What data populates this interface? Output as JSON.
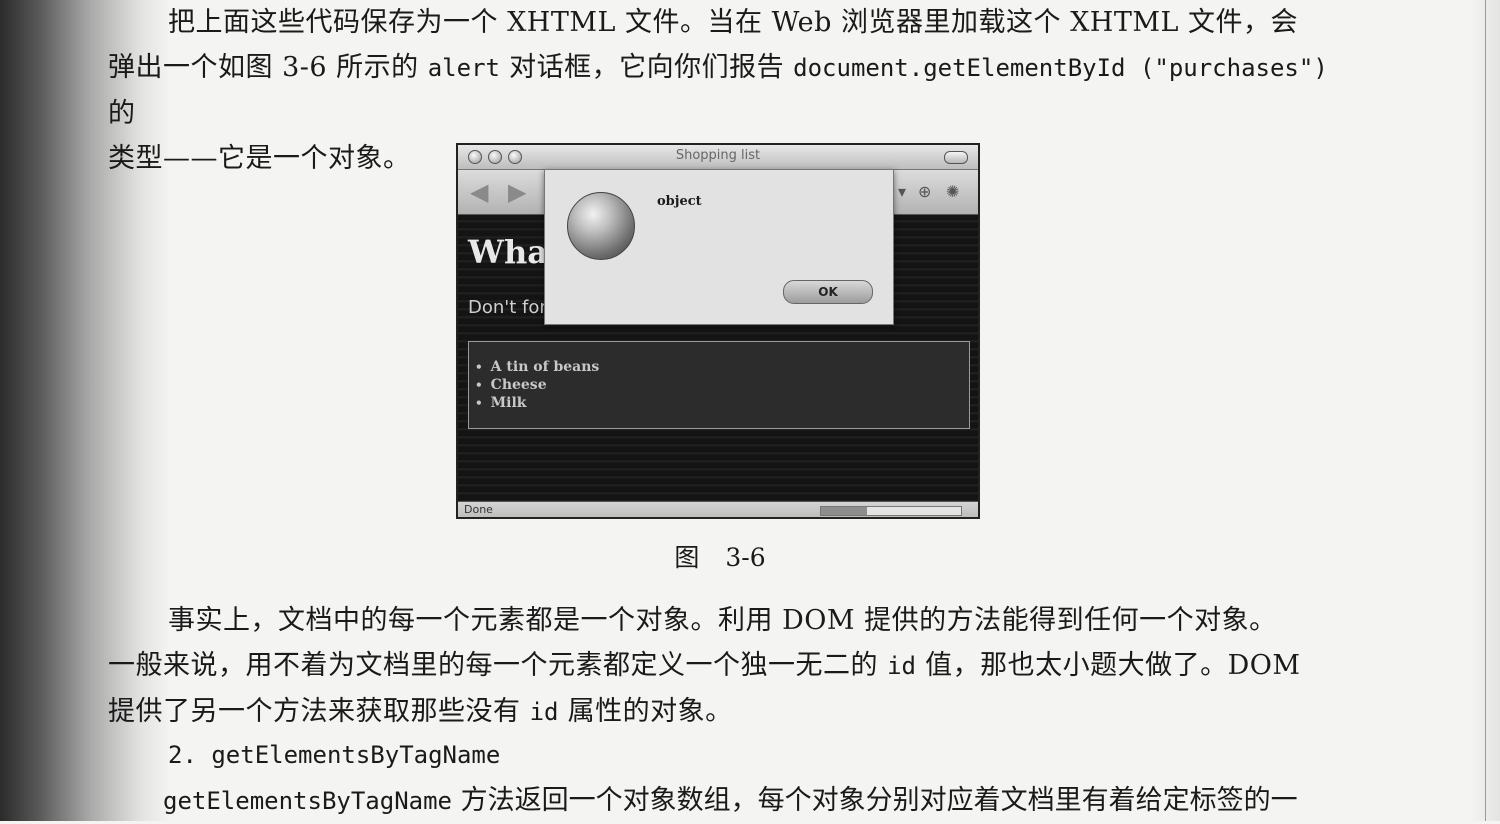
{
  "paragraph_1": {
    "line_1": "把上面这些代码保存为一个 XHTML 文件。当在 Web 浏览器里加载这个 XHTML 文件，会",
    "line_2_a": "弹出一个如图 3-6 所示的 ",
    "line_2_code_1": "alert",
    "line_2_b": " 对话框，它向你们报告 ",
    "line_2_code_2": "document.getElementById (\"purchases\")",
    "line_2_c": "的",
    "line_3": "类型——它是一个对象。"
  },
  "figure": {
    "window_title": "Shopping list",
    "heading_partial": "What",
    "subtext_partial": "Don't for",
    "list_items": [
      "A tin of beans",
      "Cheese",
      "Milk"
    ],
    "status_text": "Done",
    "progress": 0.33,
    "dialog": {
      "message": "object",
      "ok_label": "OK"
    },
    "caption": "图 3-6"
  },
  "paragraph_2": {
    "line_1": "事实上，文档中的每一个元素都是一个对象。利用 DOM 提供的方法能得到任何一个对象。",
    "line_2_a": "一般来说，用不着为文档里的每一个元素都定义一个独一无二的 ",
    "line_2_code": "id",
    "line_2_b": " 值，那也太小题大做了。DOM",
    "line_3_a": "提供了另一个方法来获取那些没有 ",
    "line_3_code": "id",
    "line_3_b": " 属性的对象。"
  },
  "section_heading": "2. getElementsByTagName",
  "paragraph_3": {
    "code": "getElementsByTagName",
    "text": " 方法返回一个对象数组，每个对象分别对应着文档里有着给定标签的一"
  },
  "colors": {
    "page": "#f4f4f2",
    "text": "#1a1a1a",
    "figure_bg": "#1a1a1a"
  }
}
